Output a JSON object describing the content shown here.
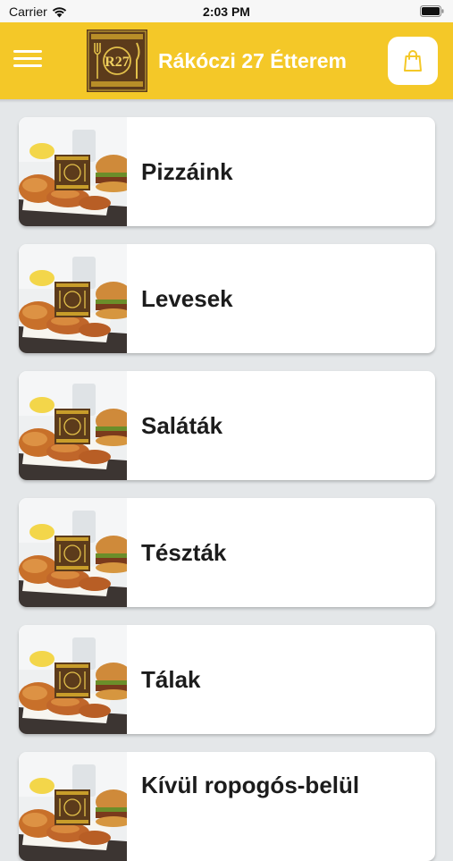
{
  "status_bar": {
    "carrier": "Carrier",
    "time": "2:03 PM"
  },
  "header": {
    "title": "Rákóczi 27 Étterem",
    "logo_text": "R27",
    "accent_color": "#f4c828",
    "menu_icon": "hamburger-menu-icon",
    "cart_icon": "shopping-bag-icon"
  },
  "categories": [
    {
      "label": "Pizzáink"
    },
    {
      "label": "Levesek"
    },
    {
      "label": "Saláták"
    },
    {
      "label": "Tészták"
    },
    {
      "label": "Tálak"
    },
    {
      "label": "Kívül ropogós-belül"
    }
  ]
}
